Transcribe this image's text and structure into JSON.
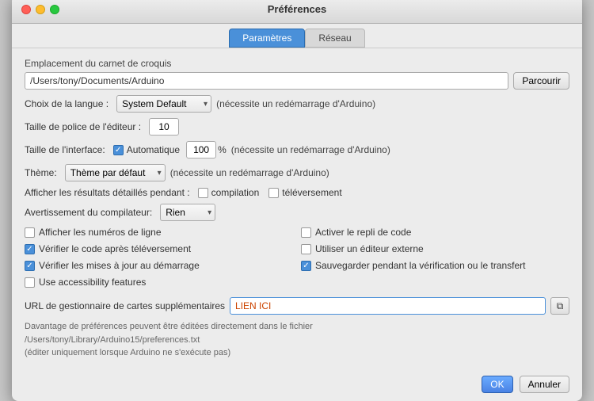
{
  "window": {
    "title": "Préférences"
  },
  "tabs": [
    {
      "id": "parametres",
      "label": "Paramètres",
      "active": true
    },
    {
      "id": "reseau",
      "label": "Réseau",
      "active": false
    }
  ],
  "sketchbook": {
    "label": "Emplacement du carnet de croquis",
    "path": "/Users/tony/Documents/Arduino",
    "browse_label": "Parcourir"
  },
  "language": {
    "label": "Choix de la langue :",
    "value": "System Default",
    "note": "(nécessite un redémarrage d'Arduino)"
  },
  "font_size": {
    "label": "Taille de police de l'éditeur :",
    "value": "10"
  },
  "interface_size": {
    "label": "Taille de l'interface:",
    "auto_label": "Automatique",
    "auto_checked": true,
    "value": "100",
    "unit": "%",
    "note": "(nécessite un redémarrage d'Arduino)"
  },
  "theme": {
    "label": "Thème:",
    "value": "Thème par défaut",
    "note": "(nécessite un redémarrage d'Arduino)"
  },
  "show_results": {
    "label": "Afficher les résultats détaillés pendant :",
    "compilation_label": "compilation",
    "compilation_checked": false,
    "upload_label": "téléversement",
    "upload_checked": false
  },
  "compiler_warning": {
    "label": "Avertissement du compilateur:",
    "value": "Rien"
  },
  "checkboxes_left": [
    {
      "id": "line-numbers",
      "label": "Afficher les numéros de ligne",
      "checked": false
    },
    {
      "id": "verify-code",
      "label": "Vérifier le code après téléversement",
      "checked": true
    },
    {
      "id": "update-check",
      "label": "Vérifier les mises à jour au démarrage",
      "checked": true
    },
    {
      "id": "accessibility",
      "label": "Use accessibility features",
      "checked": false
    }
  ],
  "checkboxes_right": [
    {
      "id": "code-folding",
      "label": "Activer le repli de code",
      "checked": false
    },
    {
      "id": "external-editor",
      "label": "Utiliser un éditeur externe",
      "checked": false
    },
    {
      "id": "save-verify",
      "label": "Sauvegarder pendant la vérification ou le transfert",
      "checked": true
    }
  ],
  "url_manager": {
    "label": "URL de gestionnaire de cartes supplémentaires",
    "value": "LIEN ICI",
    "btn_icon": "⧉"
  },
  "footer": {
    "line1": "Davantage de préférences peuvent être éditées directement dans le fichier",
    "line2": "/Users/tony/Library/Arduino15/preferences.txt",
    "line3": "(éditer uniquement lorsque Arduino ne s'exécute pas)"
  },
  "buttons": {
    "ok_label": "OK",
    "cancel_label": "Annuler"
  }
}
